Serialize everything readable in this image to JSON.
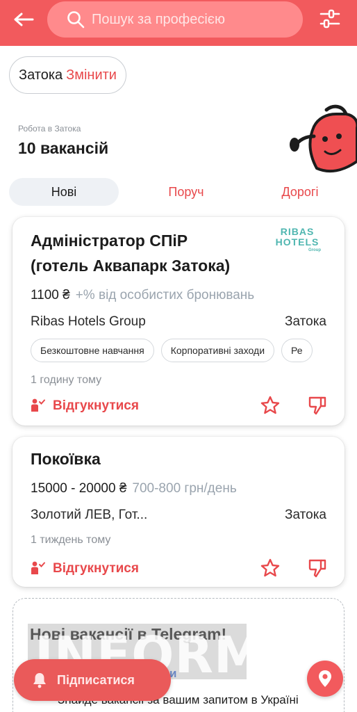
{
  "header": {
    "search_placeholder": "Пошук за професією",
    "colors": {
      "bar": "#f25a5d",
      "search_bg": "#ff8a8c"
    }
  },
  "location": {
    "city": "Затока",
    "change_label": "Змінити"
  },
  "results": {
    "subtitle": "Робота в Затока",
    "count_title": "10 вакансій"
  },
  "tabs": [
    {
      "label": "Нові",
      "active": true
    },
    {
      "label": "Поруч",
      "active": false
    },
    {
      "label": "Дорогі",
      "active": false
    }
  ],
  "jobs": [
    {
      "title_line1": "Адміністратор СПіР",
      "title_line2": "(готель Аквапарк Затока)",
      "salary": "1100 ₴",
      "salary_extra": "+% від особистих бронювань",
      "company": "Ribas Hotels Group",
      "city": "Затока",
      "logo_line1": "RIBAS",
      "logo_line2": "HOTELS",
      "logo_line3": "Group",
      "tags": [
        "Безкоштовне навчання",
        "Корпоративні заходи",
        "Ре"
      ],
      "time_ago": "1 годину тому",
      "apply_label": "Відгукнутися"
    },
    {
      "title_line1": "Покоївка",
      "salary": "15000 - 20000 ₴",
      "salary_extra": "700-800 грн/день",
      "company": "Золотий ЛЕВ, Гот...",
      "city": "Затока",
      "time_ago": "1 тиждень тому",
      "apply_label": "Відгукнутися"
    }
  ],
  "promo": {
    "title": "Нові вакансії в Telegram!",
    "link_fragment": "и",
    "description": "Знайде вакансії за вашим запитом в Україні"
  },
  "subscribe": {
    "label": "Підписатися"
  },
  "watermark": {
    "text": "INFORM"
  },
  "icons": {
    "back": "arrow-left-icon",
    "search": "search-icon",
    "filter": "sliders-icon",
    "apply": "person-check-icon",
    "favorite": "star-icon",
    "dislike": "thumbs-down-icon",
    "bell": "bell-icon",
    "map": "map-pin-icon"
  },
  "accent_color": "#e8484b"
}
